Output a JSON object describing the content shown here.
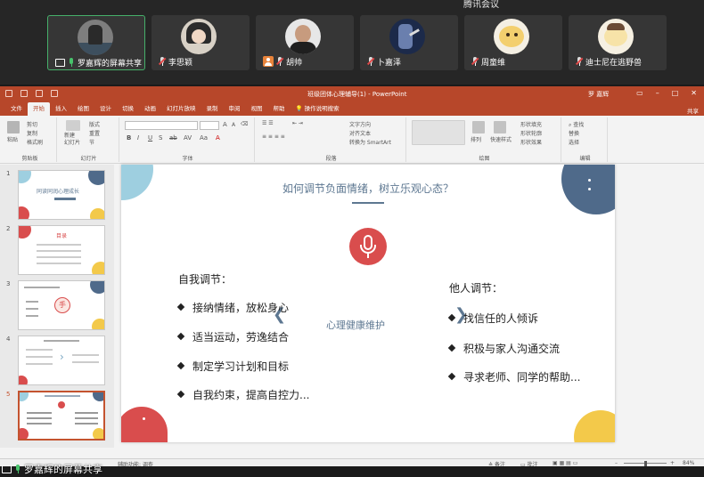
{
  "meeting": {
    "title": "腾讯会议",
    "participants": [
      {
        "name": "罗嘉辉的屏幕共享",
        "status": "sharing"
      },
      {
        "name": "李思颖",
        "status": "muted"
      },
      {
        "name": "胡帅",
        "status": "muted"
      },
      {
        "name": "卜嘉泽",
        "status": "muted"
      },
      {
        "name": "周童维",
        "status": "muted"
      },
      {
        "name": "迪士尼在逃野兽",
        "status": "muted"
      }
    ],
    "share_label": "罗嘉辉的屏幕共享"
  },
  "ppt": {
    "doc_title": "班级团体心理辅导(1) - PowerPoint",
    "user": "罗 嘉辉",
    "share_button": "共享",
    "tabs": [
      "文件",
      "开始",
      "插入",
      "绘图",
      "设计",
      "切换",
      "动画",
      "幻灯片放映",
      "录制",
      "审阅",
      "视图",
      "帮助",
      "操作说明搜索"
    ],
    "active_tab": "开始",
    "ribbon": {
      "clipboard": {
        "paste": "粘贴",
        "cut": "剪切",
        "copy": "复制",
        "format_painter": "格式刷",
        "label": "剪贴板"
      },
      "slides": {
        "new_slide": "新建\n幻灯片",
        "layout": "版式",
        "reset": "重置",
        "section": "节",
        "label": "幻灯片"
      },
      "font": {
        "label": "字体"
      },
      "paragraph": {
        "text_direction": "文字方向",
        "align_text": "对齐文本",
        "smartart": "转换为 SmartArt",
        "label": "段落"
      },
      "drawing": {
        "arrange": "排列",
        "quick_styles": "快速样式",
        "fill": "形状填充",
        "outline": "形状轮廓",
        "effects": "形状效果",
        "label": "绘图"
      },
      "editing": {
        "find": "查找",
        "replace": "替换",
        "select": "选择",
        "label": "编辑"
      }
    },
    "thumbnails": [
      {
        "number": "1",
        "title": "同读同润心理成长"
      },
      {
        "number": "2",
        "title": "目录"
      },
      {
        "number": "3",
        "title": "手"
      },
      {
        "number": "4",
        "title": ""
      },
      {
        "number": "5",
        "title": ""
      }
    ],
    "slide": {
      "title": "如何调节负面情绪，树立乐观心态？",
      "center_label": "心理健康维护",
      "left_heading": "自我调节：",
      "left_items": [
        "接纳情绪，放松身心",
        "适当运动，劳逸结合",
        "制定学习计划和目标",
        "自我约束，提高自控力..."
      ],
      "right_heading": "他人调节：",
      "right_items": [
        "找信任的人倾诉",
        "积极与家人沟通交流",
        "寻求老师、同学的帮助..."
      ]
    },
    "status": {
      "accessibility": "辅助功能: 调查",
      "notes": "备注",
      "comments": "批注",
      "zoom": "84%"
    }
  },
  "colors": {
    "ppt_accent": "#b7472a",
    "slide_red": "#d94d4d",
    "slide_blue": "#4f6a8a",
    "slide_yellow": "#f3c94a",
    "slide_lightblue": "#9ecfe0"
  }
}
